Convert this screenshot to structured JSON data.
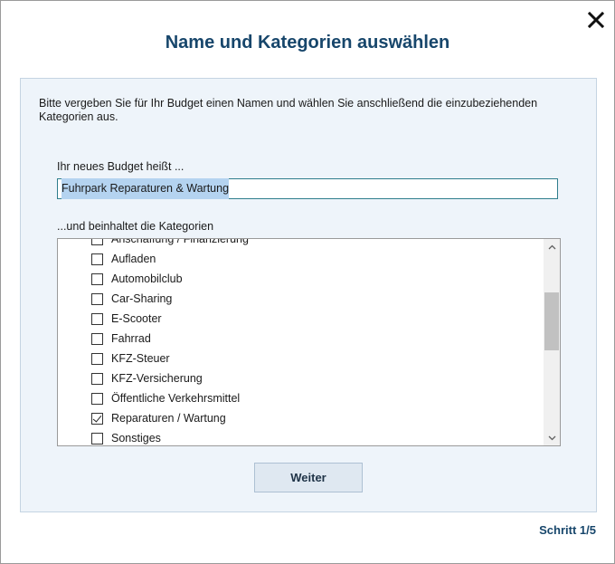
{
  "dialog": {
    "title": "Name und Kategorien auswählen",
    "close_icon": "close-icon",
    "intro": "Bitte vergeben Sie für Ihr Budget einen Namen und wählen Sie anschließend die einzubeziehenden Kategorien aus.",
    "name_label": "Ihr neues Budget heißt ...",
    "name_value": "Fuhrpark Reparaturen & Wartung",
    "categories_label": "...und beinhaltet die Kategorien",
    "categories": [
      {
        "label": "Anschaffung / Finanzierung",
        "checked": false
      },
      {
        "label": "Aufladen",
        "checked": false
      },
      {
        "label": "Automobilclub",
        "checked": false
      },
      {
        "label": "Car-Sharing",
        "checked": false
      },
      {
        "label": "E-Scooter",
        "checked": false
      },
      {
        "label": "Fahrrad",
        "checked": false
      },
      {
        "label": "KFZ-Steuer",
        "checked": false
      },
      {
        "label": "KFZ-Versicherung",
        "checked": false
      },
      {
        "label": "Öffentliche Verkehrsmittel",
        "checked": false
      },
      {
        "label": "Reparaturen / Wartung",
        "checked": true
      },
      {
        "label": "Sonstiges",
        "checked": false
      }
    ],
    "next_button": "Weiter",
    "step": "Schritt 1/5"
  }
}
